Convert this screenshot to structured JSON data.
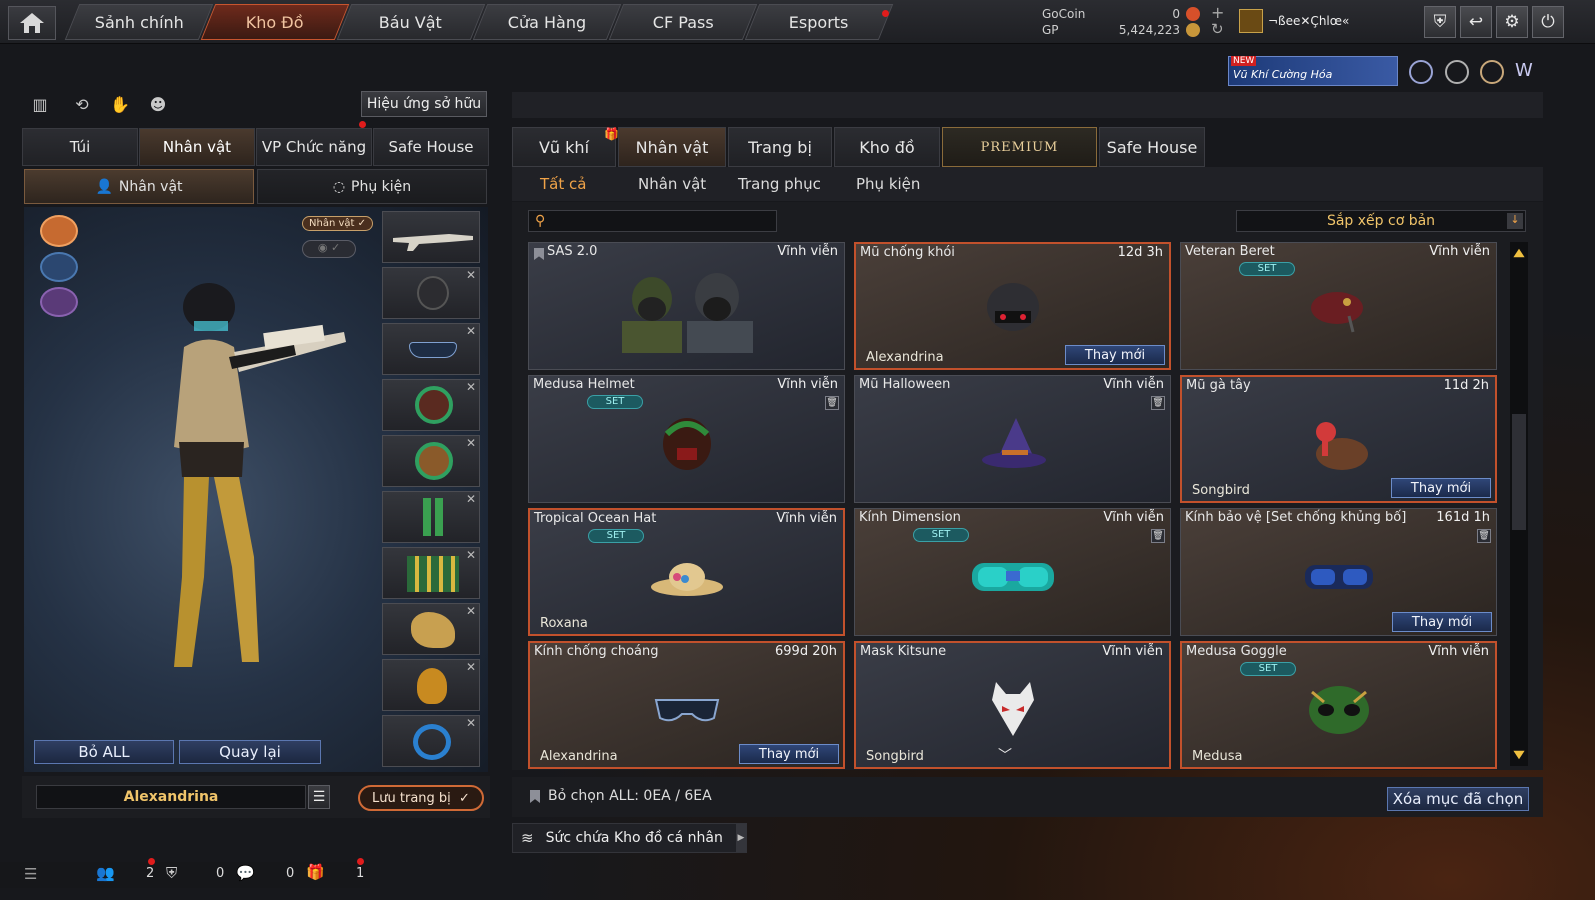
{
  "nav": {
    "tabs": [
      "Sảnh chính",
      "Kho Đồ",
      "Báu Vật",
      "Cửa Hàng",
      "CF Pass",
      "Esports"
    ],
    "active": "Kho Đồ"
  },
  "currency": {
    "gocoin_label": "GoCoin",
    "gocoin_value": "0",
    "gp_label": "GP",
    "gp_value": "5,424,223"
  },
  "user": {
    "name": "¬ßee✕Çhlœ«"
  },
  "promo": {
    "new_label": "NEW",
    "text": "Vũ Khí Cường Hóa"
  },
  "left": {
    "effects_button": "Hiệu ứng sở hữu",
    "tabs": [
      "Túi",
      "Nhân vật",
      "VP Chức năng",
      "Safe House"
    ],
    "active_tab": "Nhân vật",
    "subtabs": [
      "Nhân vật",
      "Phụ kiện"
    ],
    "badge": "Nhân vật",
    "remove_all": "Bỏ ALL",
    "back": "Quay lại",
    "character_name": "Alexandrina",
    "save": "Lưu trang bị"
  },
  "right": {
    "tabs": [
      "Vũ khí",
      "Nhân vật",
      "Trang bị",
      "Kho đồ",
      "PREMIUM",
      "Safe House"
    ],
    "active_tab": "Nhân vật",
    "filters": [
      "Tất cả",
      "Nhân vật",
      "Trang phục",
      "Phụ kiện"
    ],
    "active_filter": "Tất cả",
    "search_placeholder": "",
    "sort": "Sắp xếp cơ bản",
    "deselect": "Bỏ chọn ALL: 0EA / 6EA",
    "delete_selected": "Xóa mục đã chọn",
    "capacity": "Sức chứa Kho đồ cá nhân"
  },
  "items": [
    {
      "name": "SAS 2.0",
      "duration": "Vĩnh viễn",
      "set": false,
      "owner": "",
      "change": "",
      "icon": "soldiers",
      "pinned": true,
      "locked": false,
      "selected": false,
      "warm": false
    },
    {
      "name": "Mũ chống khói",
      "duration": "12d 3h",
      "set": false,
      "owner": "Alexandrina",
      "change": "Thay mới",
      "icon": "gasmask-helmet",
      "pinned": false,
      "locked": false,
      "selected": true,
      "warm": true
    },
    {
      "name": "Veteran Beret",
      "duration": "Vĩnh viễn",
      "set": true,
      "owner": "",
      "change": "",
      "icon": "beret",
      "pinned": false,
      "locked": false,
      "selected": false,
      "warm": true
    },
    {
      "name": "Medusa Helmet",
      "duration": "Vĩnh viễn",
      "set": true,
      "owner": "",
      "change": "",
      "icon": "medusa-helmet",
      "pinned": false,
      "locked": true,
      "selected": false,
      "warm": false
    },
    {
      "name": "Mũ Halloween",
      "duration": "Vĩnh viễn",
      "set": false,
      "owner": "",
      "change": "",
      "icon": "witch-hat",
      "pinned": false,
      "locked": true,
      "selected": false,
      "warm": false
    },
    {
      "name": "Mũ gà tây",
      "duration": "11d 2h",
      "set": false,
      "owner": "Songbird",
      "change": "Thay mới",
      "icon": "turkey-hat",
      "pinned": false,
      "locked": false,
      "selected": true,
      "warm": false
    },
    {
      "name": "Tropical Ocean Hat",
      "duration": "Vĩnh viễn",
      "set": true,
      "owner": "Roxana",
      "change": "",
      "icon": "straw-hat",
      "pinned": false,
      "locked": false,
      "selected": true,
      "warm": false
    },
    {
      "name": "Kính Dimension",
      "duration": "Vĩnh viễn",
      "set": true,
      "owner": "",
      "change": "",
      "icon": "teal-goggles",
      "pinned": false,
      "locked": true,
      "selected": false,
      "warm": true
    },
    {
      "name": "Kính bảo vệ [Set chống khủng bố]",
      "duration": "161d 1h",
      "set": false,
      "owner": "",
      "change": "Thay mới",
      "icon": "blue-goggles",
      "pinned": false,
      "locked": true,
      "selected": false,
      "warm": true
    },
    {
      "name": "Kính chống choáng",
      "duration": "699d 20h",
      "set": false,
      "owner": "Alexandrina",
      "change": "Thay mới",
      "icon": "sunglasses",
      "pinned": false,
      "locked": false,
      "selected": true,
      "warm": true
    },
    {
      "name": "Mask Kitsune",
      "duration": "Vĩnh viễn",
      "set": false,
      "owner": "Songbird",
      "change": "",
      "icon": "fox-mask",
      "pinned": false,
      "locked": false,
      "selected": true,
      "warm": false
    },
    {
      "name": "Medusa Goggle",
      "duration": "Vĩnh viễn",
      "set": true,
      "owner": "Medusa",
      "change": "",
      "icon": "medusa-mask",
      "pinned": false,
      "locked": false,
      "selected": true,
      "warm": true
    }
  ],
  "set_label": "SET",
  "bottom": {
    "friends": "2",
    "messages": "0",
    "gifts_count": "0",
    "gifts": "1"
  },
  "colors": {
    "accent": "#c2512c",
    "set": "#3aa0a6",
    "filter_active": "#f0a348"
  }
}
